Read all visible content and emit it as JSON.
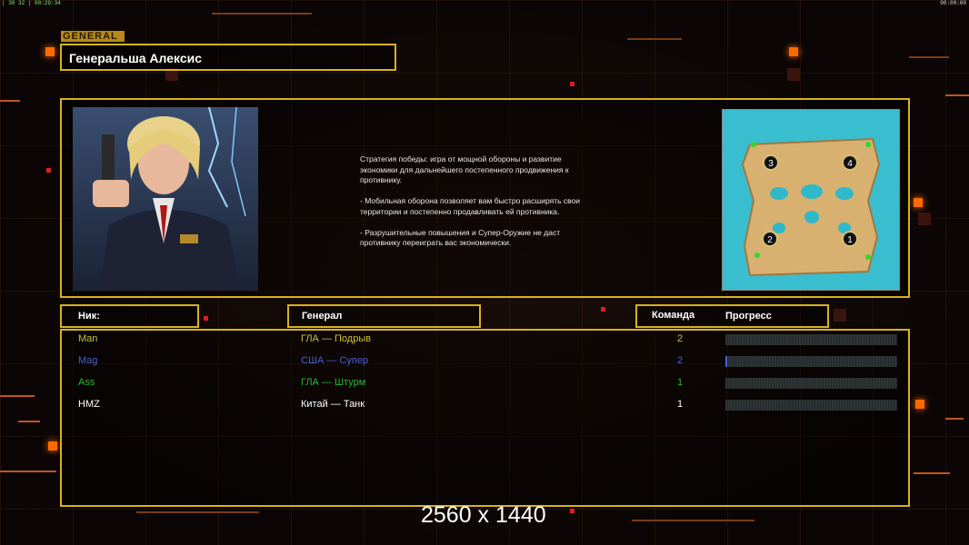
{
  "status": {
    "left": "| 30 32 | 00:29:34",
    "right": "00:00:00"
  },
  "header": {
    "tag": "GENERAL",
    "title": "Генеральша Алексис"
  },
  "description": "Стратегия победы: игра от мощной обороны и развитие\n экономики для дальнейшего постепенного продвижения к\n противнику.\n\n- Мобильная оборона позволяет вам быстро расширять свои\n территории и постепенно продавливать ей противника.\n\n- Разрушительные повышения и Супер-Оружие не даст\n противнику переиграть вас экономически.",
  "map": {
    "positions": [
      "1",
      "2",
      "3",
      "4"
    ]
  },
  "columns": {
    "nick": "Ник:",
    "general": "Генерал",
    "team": "Команда",
    "progress": "Прогресс"
  },
  "players": [
    {
      "nick": "Man",
      "general": "ГЛА — Подрыв",
      "team": "2",
      "color": "#c9c23a",
      "progress": 0.0
    },
    {
      "nick": "Mag",
      "general": "США — Супер",
      "team": "2",
      "color": "#4a5fd8",
      "progress": 0.01
    },
    {
      "nick": "Ass",
      "general": "ГЛА — Штурм",
      "team": "1",
      "color": "#2fb52f",
      "progress": 0.0
    },
    {
      "nick": "HMZ",
      "general": "Китай — Танк",
      "team": "1",
      "color": "#ffffff",
      "progress": 0.0
    }
  ],
  "watermark": "2560 x 1440"
}
